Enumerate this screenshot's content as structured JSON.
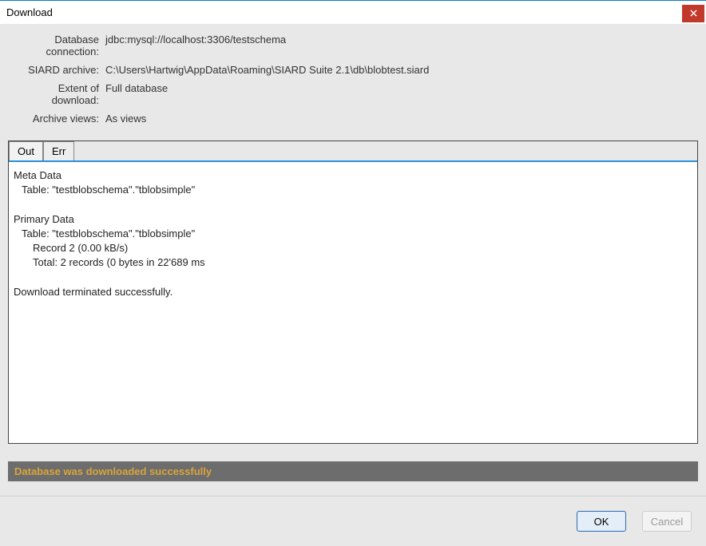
{
  "window": {
    "title": "Download"
  },
  "info": {
    "label_db_conn": "Database connection:",
    "value_db_conn": "jdbc:mysql://localhost:3306/testschema",
    "label_siard": "SIARD archive:",
    "value_siard": "C:\\Users\\Hartwig\\AppData\\Roaming\\SIARD Suite 2.1\\db\\blobtest.siard",
    "label_extent": "Extent of download:",
    "value_extent": "Full database",
    "label_views": "Archive views:",
    "value_views": "As views"
  },
  "tabs": {
    "out": "Out",
    "err": "Err"
  },
  "log": {
    "meta_header": "Meta Data",
    "meta_table": "Table: \"testblobschema\".\"tblobsimple\"",
    "primary_header": "Primary Data",
    "primary_table": "Table: \"testblobschema\".\"tblobsimple\"",
    "record_line": "Record 2 (0.00 kB/s)",
    "total_line": "Total: 2 records (0 bytes in 22'689 ms",
    "final_line": "Download terminated successfully."
  },
  "status": {
    "message": "Database was downloaded successfully"
  },
  "buttons": {
    "ok": "OK",
    "cancel": "Cancel"
  }
}
